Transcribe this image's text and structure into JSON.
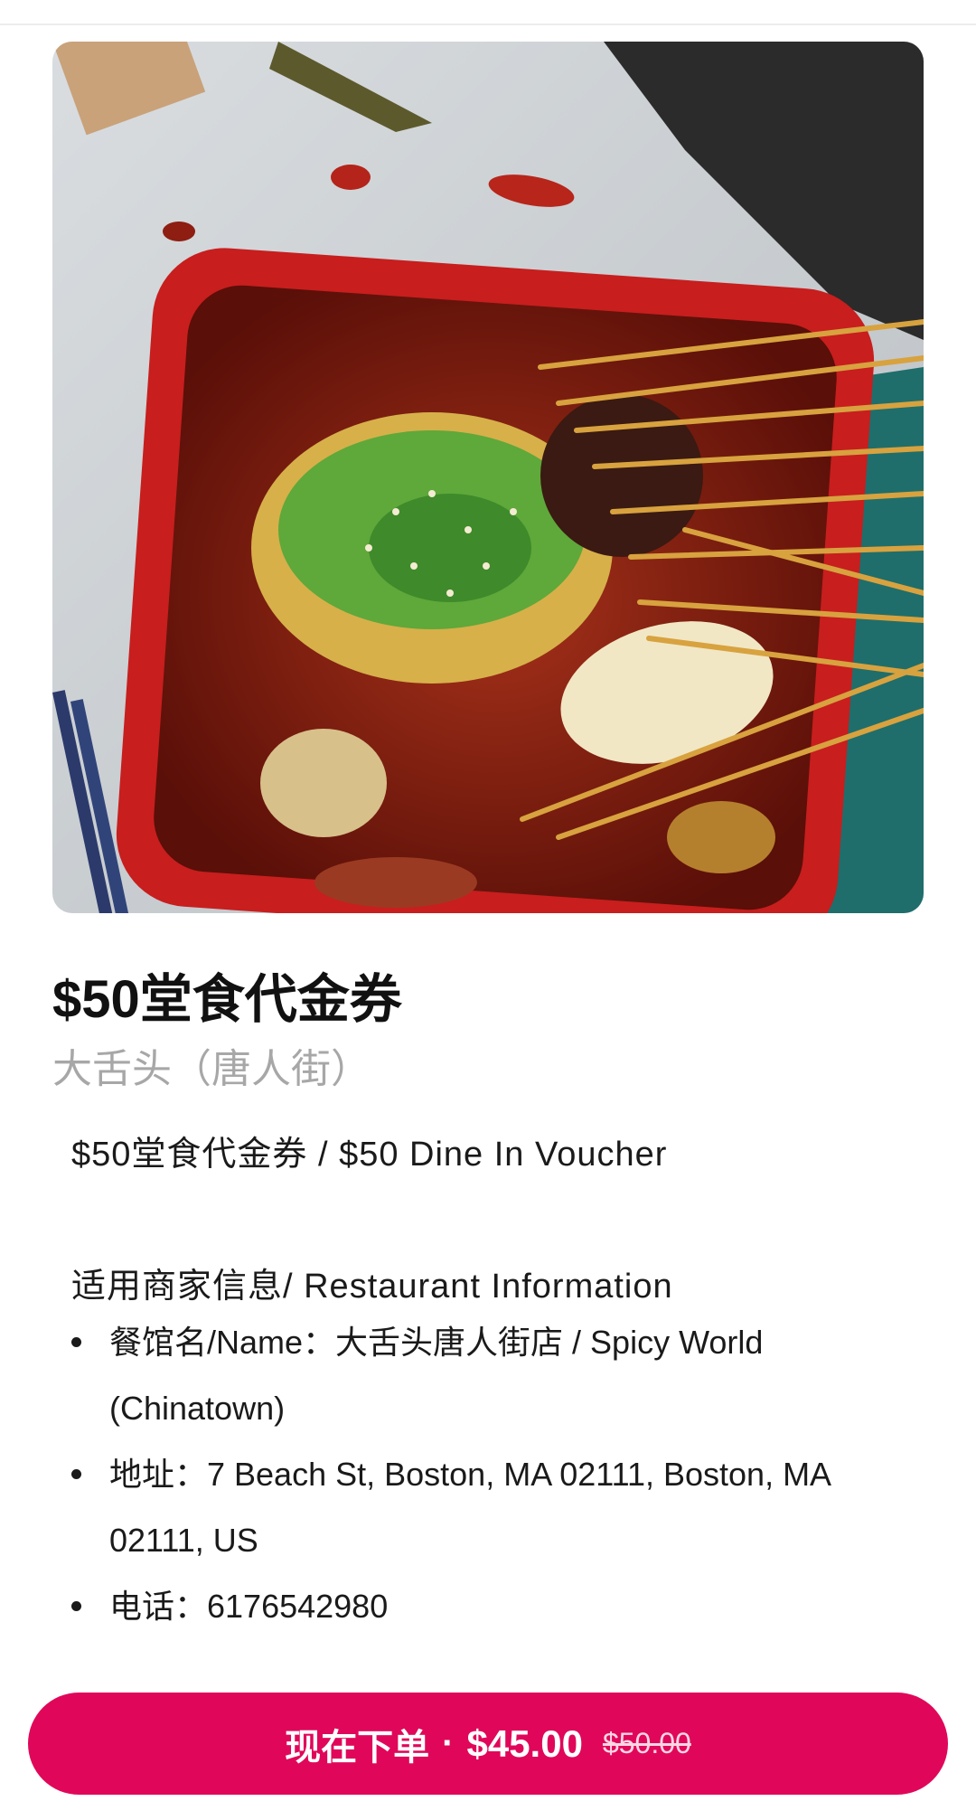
{
  "product": {
    "title": "$50堂食代金券",
    "merchant": "大舌头（唐人街）"
  },
  "description": {
    "voucher_line": "$50堂食代金券 / $50 Dine In Voucher",
    "section_heading": "适用商家信息/ Restaurant Information",
    "info_items": [
      "餐馆名/Name：大舌头唐人街店 / Spicy World (Chinatown)",
      "地址：7 Beach St, Boston, MA 02111, Boston, MA 02111, US",
      "电话：6176542980"
    ]
  },
  "order": {
    "label": "现在下单",
    "separator": "·",
    "price": "$45.00",
    "original_price": "$50.00"
  },
  "colors": {
    "accent": "#e0075a",
    "subtitle": "#a7a7a7"
  }
}
